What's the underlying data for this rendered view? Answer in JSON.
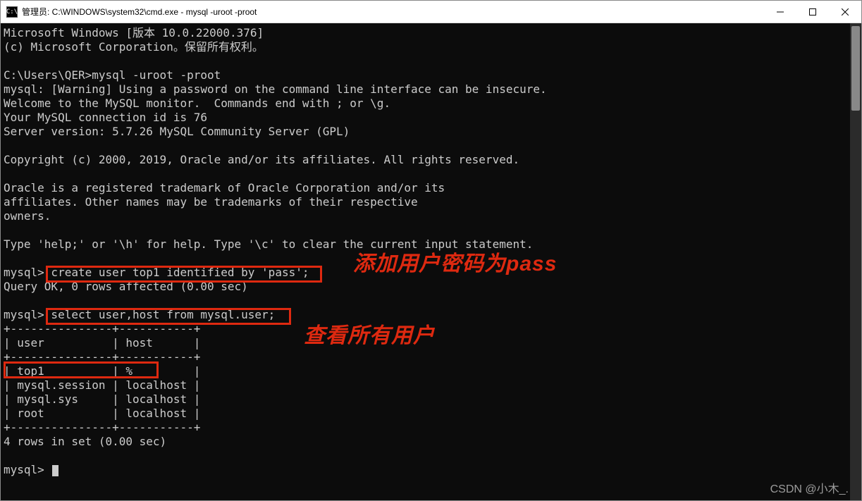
{
  "title": "管理员: C:\\WINDOWS\\system32\\cmd.exe - mysql  -uroot -proot",
  "term": {
    "l1": "Microsoft Windows [版本 10.0.22000.376]",
    "l2": "(c) Microsoft Corporation。保留所有权利。",
    "l3": "",
    "l4": "C:\\Users\\QER>mysql -uroot -proot",
    "l5": "mysql: [Warning] Using a password on the command line interface can be insecure.",
    "l6": "Welcome to the MySQL monitor.  Commands end with ; or \\g.",
    "l7": "Your MySQL connection id is 76",
    "l8": "Server version: 5.7.26 MySQL Community Server (GPL)",
    "l9": "",
    "l10": "Copyright (c) 2000, 2019, Oracle and/or its affiliates. All rights reserved.",
    "l11": "",
    "l12": "Oracle is a registered trademark of Oracle Corporation and/or its",
    "l13": "affiliates. Other names may be trademarks of their respective",
    "l14": "owners.",
    "l15": "",
    "l16": "Type 'help;' or '\\h' for help. Type '\\c' to clear the current input statement.",
    "l17": "",
    "l18": "mysql> create user top1 identified by 'pass';",
    "l19": "Query OK, 0 rows affected (0.00 sec)",
    "l20": "",
    "l21": "mysql> select user,host from mysql.user;",
    "l22": "+---------------+-----------+",
    "l23": "| user          | host      |",
    "l24": "+---------------+-----------+",
    "l25": "| top1          | %         |",
    "l26": "| mysql.session | localhost |",
    "l27": "| mysql.sys     | localhost |",
    "l28": "| root          | localhost |",
    "l29": "+---------------+-----------+",
    "l30": "4 rows in set (0.00 sec)",
    "l31": "",
    "l32": "mysql> "
  },
  "annotations": {
    "a1": "添加用户密码为pass",
    "a2": "查看所有用户"
  },
  "watermark": "CSDN @小木_."
}
